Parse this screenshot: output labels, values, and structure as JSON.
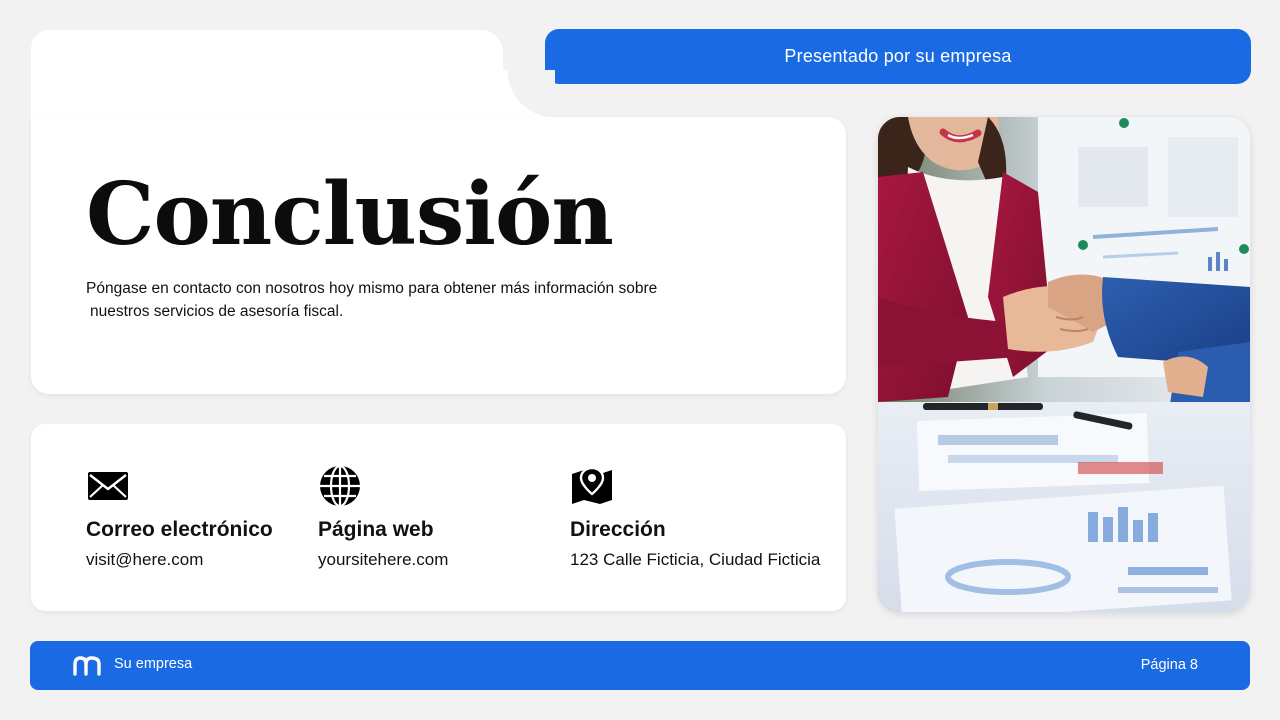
{
  "banner": {
    "text": "Presentado por su empresa"
  },
  "main": {
    "title": "Conclusión",
    "description_line1": "Póngase en contacto con nosotros hoy mismo para obtener más información sobre",
    "description_line2": "nuestros servicios de asesoría fiscal."
  },
  "contacts": [
    {
      "label": "Correo electrónico",
      "value": "visit@here.com",
      "icon": "envelope-icon"
    },
    {
      "label": "Página web",
      "value": "yoursitehere.com",
      "icon": "globe-icon"
    },
    {
      "label": "Dirección",
      "value": "123 Calle Ficticia, Ciudad Ficticia",
      "icon": "map-pin-icon"
    }
  ],
  "footer": {
    "company": "Su empresa",
    "page": "Página 8",
    "logo_icon": "company-logo-icon"
  },
  "photo": {
    "subject": "handshake-photo"
  },
  "colors": {
    "accent": "#1a6ae3",
    "background": "#f2f2f3",
    "card": "#ffffff",
    "text": "#111111"
  }
}
